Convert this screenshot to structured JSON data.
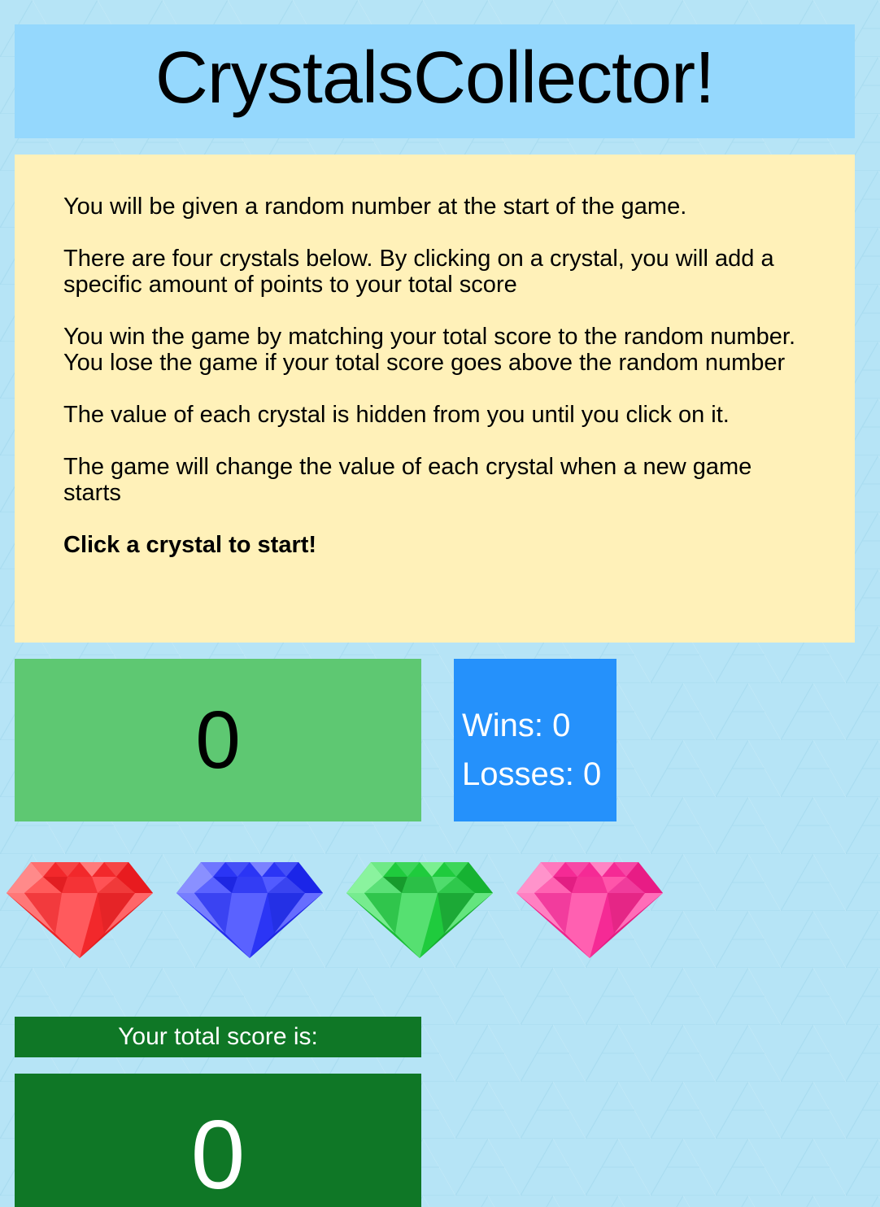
{
  "header": {
    "title": "CrystalsCollector!"
  },
  "instructions": {
    "lines": [
      "You will be given a random number at the start of the game.",
      "There are four crystals below. By clicking on a crystal, you will add a specific amount of points to your total score",
      "You win the game by matching your total score to the random number. You lose the game if your total score goes above the random number",
      "The value of each crystal is hidden from you until you click on it.",
      "The game will change the value of each crystal when a new game starts"
    ],
    "start_prompt": "Click a crystal to start!"
  },
  "random_number": "0",
  "stats": {
    "wins": "Wins: 0",
    "losses": "Losses: 0"
  },
  "crystals": [
    {
      "icon": "red-crystal-icon",
      "color": "#f2282b"
    },
    {
      "icon": "blue-crystal-icon",
      "color": "#2b35f5"
    },
    {
      "icon": "green-crystal-icon",
      "color": "#1fcb3d"
    },
    {
      "icon": "pink-crystal-icon",
      "color": "#f52a95"
    }
  ],
  "score": {
    "label": "Your total score is:",
    "value": "0"
  },
  "colors": {
    "background": "#b6e4f6",
    "header": "#95d8fd",
    "instructions": "#fff1b9",
    "random_box": "#5ec872",
    "stats_box": "#2591fb",
    "score": "#0f7726"
  }
}
